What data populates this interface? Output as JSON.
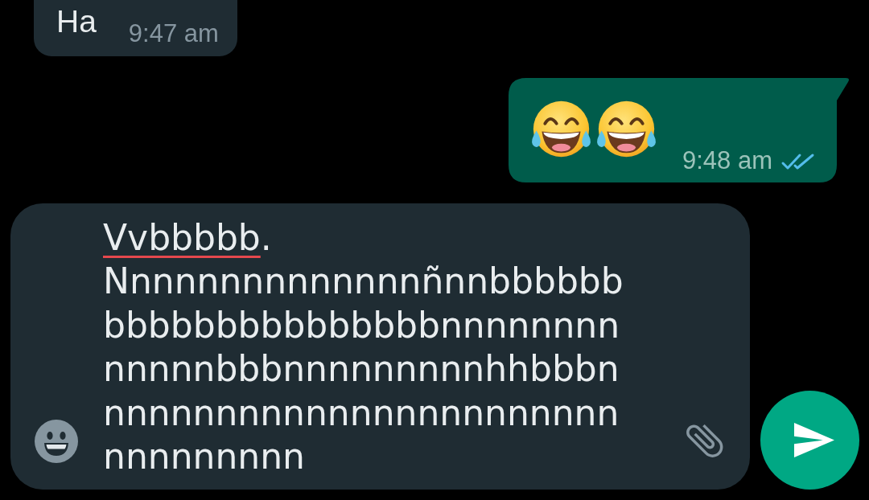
{
  "messages": [
    {
      "outgoing": false,
      "text": "Ha",
      "time": "9:47 am"
    },
    {
      "outgoing": true,
      "emojis": [
        {
          "kind": "laughing"
        },
        {
          "kind": "laughing"
        }
      ],
      "time": "9:48 am",
      "read": true
    }
  ],
  "composer": {
    "lines": [
      {
        "segments": [
          {
            "text": "Vvbbbbb",
            "misspelled": true
          },
          {
            "text": ".",
            "misspelled": false
          }
        ]
      },
      {
        "segments": [
          {
            "text": "Nnnnnnnnnnnnnnñnnbbbbbb",
            "misspelled": false
          }
        ]
      },
      {
        "segments": [
          {
            "text": "bbbbbbbbbbbbbbbnnnnnnnn",
            "misspelled": false
          }
        ]
      },
      {
        "segments": [
          {
            "text": "nnnnnbbbnnnnnnnnnhhbbbn",
            "misspelled": false
          }
        ]
      },
      {
        "segments": [
          {
            "text": "nnnnnnnnnnnnnnnnnnnnnnn",
            "misspelled": false
          }
        ]
      },
      {
        "segments": [
          {
            "text": "nnnnnnnnn",
            "misspelled": false
          }
        ]
      }
    ]
  }
}
